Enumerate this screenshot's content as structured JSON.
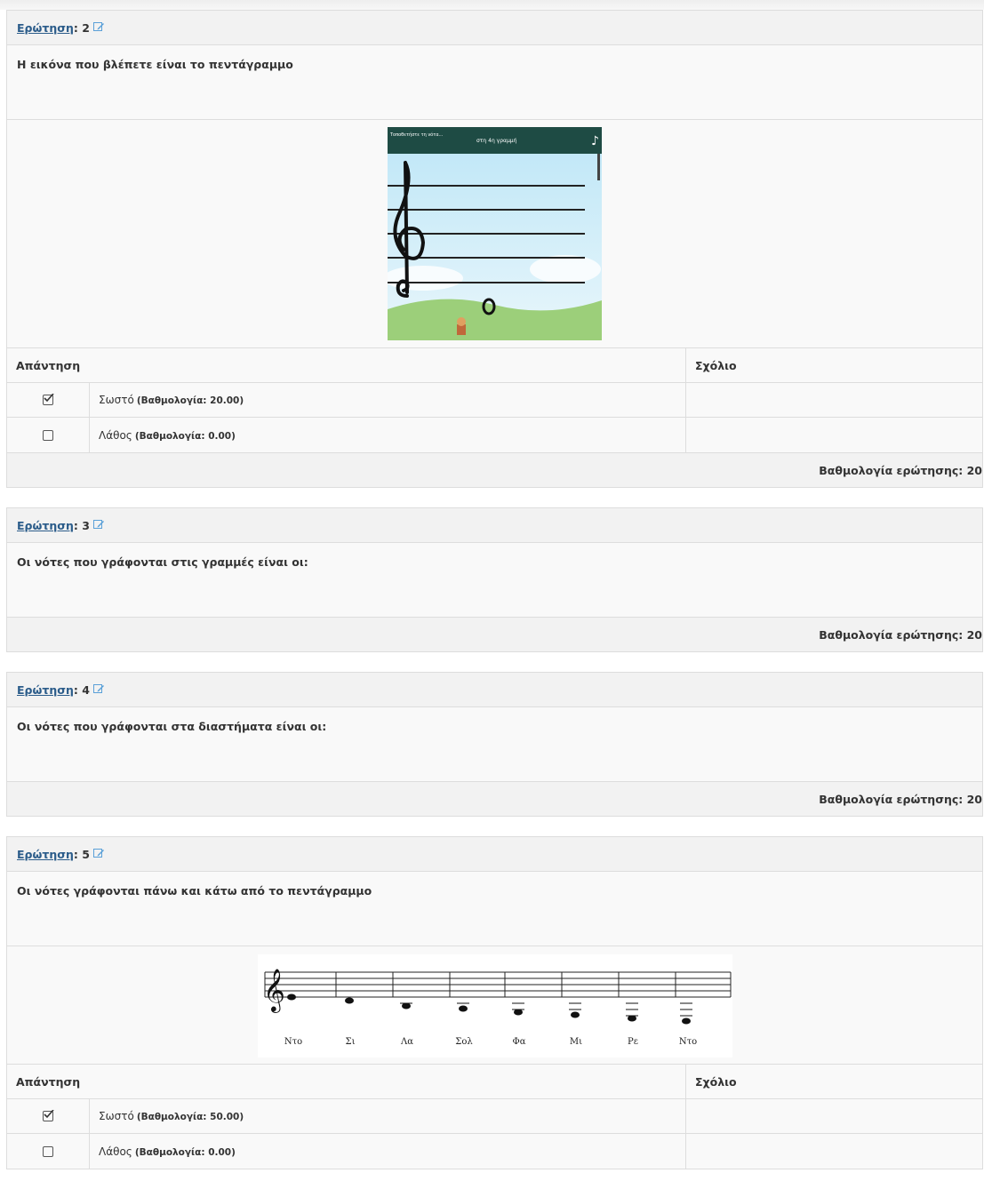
{
  "labels": {
    "question": "Ερώτηση",
    "answer_header": "Απάντηση",
    "comment_header": "Σχόλιο",
    "question_score_prefix": "Βαθμολογία ερώτησης:"
  },
  "questions": [
    {
      "number": ": 2",
      "text": "Η εικόνα που βλέπετε είναι το πεντάγραμμο",
      "image": {
        "header_left": "Τοποθετήστε τη νότα...",
        "header_center": "στη 4η γραμμή",
        "note_symbol": "♪"
      },
      "answers": [
        {
          "checked": true,
          "text": "Σωστό",
          "score": "(Βαθμολογία: 20.00)"
        },
        {
          "checked": false,
          "text": "Λάθος",
          "score": "(Βαθμολογία: 0.00)"
        }
      ],
      "score": "Βαθμολογία ερώτησης: 20"
    },
    {
      "number": ": 3",
      "text": "Οι νότες που γράφονται στις γραμμές είναι οι:",
      "score": "Βαθμολογία ερώτησης: 20"
    },
    {
      "number": ": 4",
      "text": "Οι νότες που γράφονται στα διαστήματα είναι οι:",
      "score": "Βαθμολογία ερώτησης: 20"
    },
    {
      "number": ": 5",
      "text": "Οι νότες γράφονται πάνω και κάτω από το πεντάγραμμο",
      "image": {
        "note_names": [
          "Ντο",
          "Σι",
          "Λα",
          "Σολ",
          "Φα",
          "Μι",
          "Ρε",
          "Ντο"
        ]
      },
      "answers": [
        {
          "checked": true,
          "text": "Σωστό",
          "score": "(Βαθμολογία: 50.00)"
        },
        {
          "checked": false,
          "text": "Λάθος",
          "score": "(Βαθμολογία: 0.00)"
        }
      ]
    }
  ]
}
